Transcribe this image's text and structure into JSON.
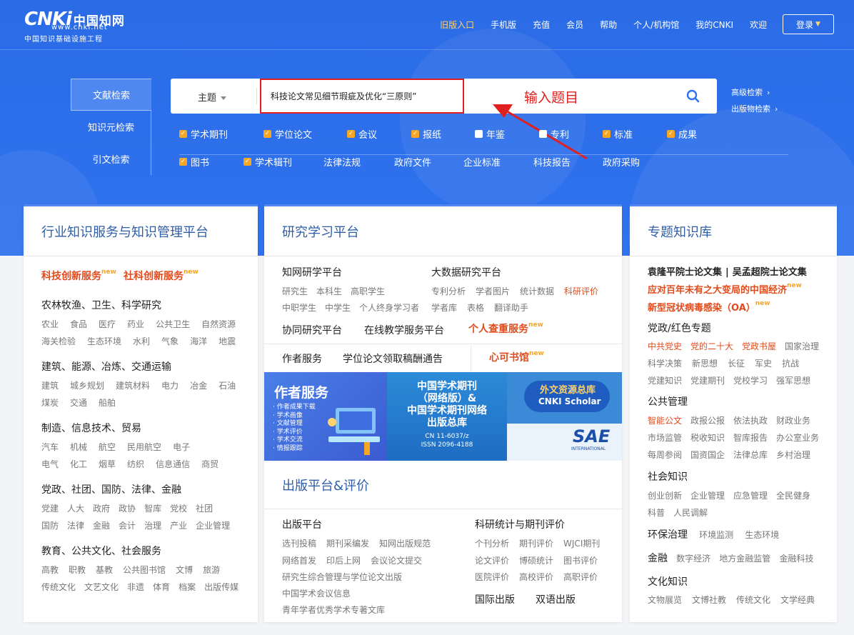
{
  "logo": {
    "cnki": "CNKi",
    "cn": "中国知网",
    "url": "www.cnki.net",
    "sub": "中国知识基础设施工程"
  },
  "nav": {
    "items": [
      "旧版入口",
      "手机版",
      "充值",
      "会员",
      "帮助",
      "个人/机构馆",
      "我的CNKI",
      "欢迎"
    ],
    "login": "登录"
  },
  "search": {
    "tabs": [
      "文献检索",
      "知识元检索",
      "引文检索"
    ],
    "field": "主题",
    "query": "科技论文常见细节瑕疵及优化“三原则”",
    "annotation": "输入题目",
    "advanced": "高级检索",
    "publication": "出版物检索"
  },
  "checkboxes": {
    "row1": [
      {
        "label": "学术期刊",
        "checked": true
      },
      {
        "label": "学位论文",
        "checked": true
      },
      {
        "label": "会议",
        "checked": true
      },
      {
        "label": "报纸",
        "checked": true
      },
      {
        "label": "年鉴",
        "checked": false
      },
      {
        "label": "专利",
        "checked": false
      },
      {
        "label": "标准",
        "checked": true
      },
      {
        "label": "成果",
        "checked": true
      }
    ],
    "row2_checked": [
      {
        "label": "图书",
        "checked": true
      },
      {
        "label": "学术辑刊",
        "checked": true
      }
    ],
    "row2_plain": [
      "法律法规",
      "政府文件",
      "企业标准",
      "科技报告",
      "政府采购"
    ]
  },
  "panel1": {
    "title": "行业知识服务与知识管理平台",
    "red1": "科技创新服务",
    "red2": "社科创新服务",
    "new": "new",
    "groups": [
      {
        "head": "农林牧渔、卫生、科学研究",
        "lines": [
          [
            "农业",
            "食品",
            "医疗",
            "药业",
            "公共卫生",
            "自然资源"
          ],
          [
            "海关检验",
            "生态环境",
            "水利",
            "气象",
            "海洋",
            "地震"
          ]
        ]
      },
      {
        "head": "建筑、能源、冶炼、交通运输",
        "lines": [
          [
            "建筑",
            "城乡规划",
            "建筑材料",
            "电力",
            "冶金",
            "石油"
          ],
          [
            "煤炭",
            "交通",
            "船舶"
          ]
        ]
      },
      {
        "head": "制造、信息技术、贸易",
        "lines": [
          [
            "汽车",
            "机械",
            "航空",
            "民用航空",
            "电子"
          ],
          [
            "电气",
            "化工",
            "烟草",
            "纺织",
            "信息通信",
            "商贸"
          ]
        ]
      },
      {
        "head": "党政、社团、国防、法律、金融",
        "lines": [
          [
            "党建",
            "人大",
            "政府",
            "政协",
            "智库",
            "党校",
            "社团"
          ],
          [
            "国防",
            "法律",
            "金融",
            "会计",
            "治理",
            "产业",
            "企业管理"
          ]
        ]
      },
      {
        "head": "教育、公共文化、社会服务",
        "lines": [
          [
            "高教",
            "职教",
            "基教",
            "公共图书馆",
            "文博",
            "旅游"
          ],
          [
            "传统文化",
            "文艺文化",
            "非遗",
            "体育",
            "档案",
            "出版传媒"
          ]
        ]
      }
    ]
  },
  "panel2": {
    "title": "研究学习平台",
    "yanxue": {
      "head": "知网研学平台",
      "l1": [
        "研究生",
        "本科生",
        "高职学生"
      ],
      "l2": [
        "中职学生",
        "中学生",
        "个人终身学习者"
      ]
    },
    "bigdata": {
      "head": "大数据研究平台",
      "l1": [
        "专利分析",
        "学者图片",
        "统计数据",
        "科研评价"
      ],
      "l2": [
        "学者库",
        "表格",
        "翻译助手"
      ]
    },
    "row3": [
      "协同研究平台",
      "在线教学服务平台",
      "个人查重服务"
    ],
    "row4": [
      "作者服务",
      "学位论文领取稿酬通告",
      "心可书馆"
    ],
    "new": "new",
    "banner1": {
      "title": "作者服务",
      "items": [
        "· 作者成果下载",
        "· 学术画像",
        "· 文献管理",
        "· 学术评价",
        "· 学术交流",
        "· 情报跟踪"
      ]
    },
    "banner2": {
      "lines": [
        "中国学术期刊",
        "（网络版）&",
        "中国学术期刊网络",
        "出版总库"
      ],
      "cn": "CN 11-6037/z",
      "issn": "ISSN 2096-4188"
    },
    "banner3": {
      "title": "外文资源总库",
      "sub": "CNKI Scholar",
      "sae": "SAE",
      "sae_sub": "INTERNATIONAL"
    },
    "pub_title": "出版平台&评价",
    "pub": {
      "head": "出版平台",
      "l1": [
        "选刊投稿",
        "期刊采编发",
        "知网出版规范"
      ],
      "l2": [
        "网络首发",
        "印后上网",
        "会议论文提交"
      ],
      "l3": "研究生综合管理与学位论文出版",
      "l4": "中国学术会议信息",
      "l5": "青年学者优秀学术专著文库"
    },
    "eval": {
      "head": "科研统计与期刊评价",
      "l1": [
        "个刊分析",
        "期刊评价",
        "WJCI期刊"
      ],
      "l2": [
        "论文评价",
        "博硕统计",
        "图书评价"
      ],
      "l3": [
        "医院评价",
        "高校评价",
        "高职评价"
      ],
      "l4": [
        "国际出版",
        "双语出版"
      ]
    }
  },
  "panel3": {
    "title": "专题知识库",
    "wen": [
      "袁隆平院士论文集",
      "吴孟超院士论文集"
    ],
    "red1": "应对百年未有之大变局的中国经济",
    "red2": "新型冠状病毒感染（OA）",
    "new": "new",
    "party": {
      "head": "党政/红色专题",
      "l1": [
        "中共党史",
        "党的二十大",
        "党政书屋",
        "国家治理"
      ],
      "l2": [
        "科学决策",
        "新思想",
        "长征",
        "军史",
        "抗战"
      ],
      "l3": [
        "党建知识",
        "党建期刊",
        "党校学习",
        "强军思想"
      ]
    },
    "public": {
      "head": "公共管理",
      "l1": [
        "智能公文",
        "政报公报",
        "依法执政",
        "财政业务"
      ],
      "l2": [
        "市场监管",
        "税收知识",
        "智库报告",
        "办公室业务"
      ],
      "l3": [
        "每周参阅",
        "国资国企",
        "法律总库",
        "乡村治理"
      ]
    },
    "social": {
      "head": "社会知识",
      "l1": [
        "创业创新",
        "企业管理",
        "应急管理",
        "全民健身"
      ],
      "l2": [
        "科普",
        "人民调解"
      ]
    },
    "env": {
      "head": "环保治理",
      "items": [
        "环境监测",
        "生态环境"
      ]
    },
    "fin": {
      "head": "金融",
      "items": [
        "数字经济",
        "地方金融监管",
        "金融科技"
      ]
    },
    "culture": {
      "head": "文化知识",
      "items": [
        "文物展览",
        "文博社教",
        "传统文化",
        "文学经典"
      ]
    }
  },
  "colors": {
    "brand": "#2f73ee",
    "accent_red": "#e24b1c",
    "checkbox": "#f6a623"
  }
}
